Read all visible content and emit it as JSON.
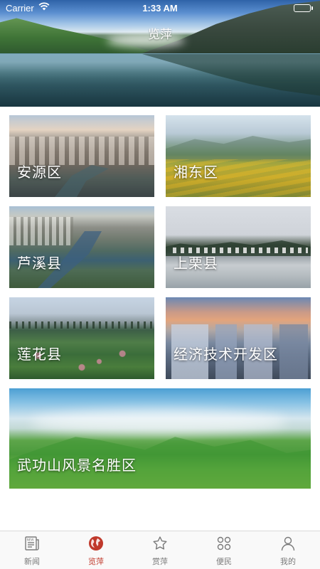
{
  "status_bar": {
    "carrier": "Carrier",
    "time": "1:33 AM"
  },
  "header": {
    "title": "览萍"
  },
  "tiles": [
    {
      "label": "安源区"
    },
    {
      "label": "湘东区"
    },
    {
      "label": "芦溪县"
    },
    {
      "label": "上栗县"
    },
    {
      "label": "莲花县"
    },
    {
      "label": "经济技术开发区"
    },
    {
      "label": "武功山风景名胜区"
    }
  ],
  "tab_bar": {
    "active_index": 1,
    "active_color": "#c0392b",
    "inactive_color": "#7a7a7a",
    "items": [
      {
        "label": "新闻",
        "icon": "newspaper-icon"
      },
      {
        "label": "览萍",
        "icon": "globe-icon"
      },
      {
        "label": "赏萍",
        "icon": "star-icon"
      },
      {
        "label": "便民",
        "icon": "grid-clover-icon"
      },
      {
        "label": "我的",
        "icon": "person-icon"
      }
    ]
  }
}
